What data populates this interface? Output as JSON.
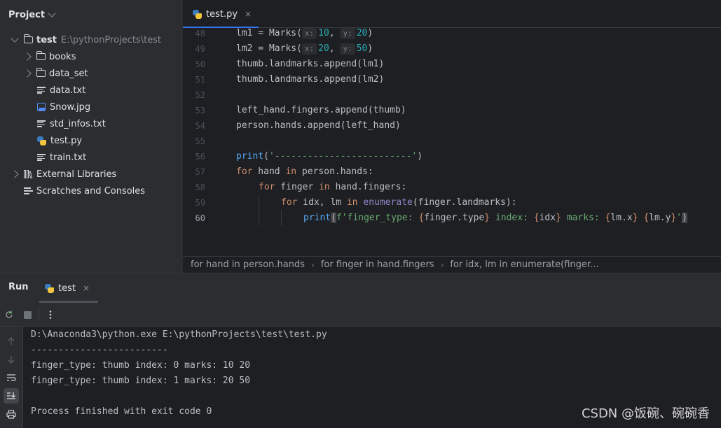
{
  "project_panel": {
    "title": "Project",
    "root": {
      "name": "test",
      "path": "E:\\pythonProjects\\test"
    },
    "items": [
      {
        "label": "books",
        "type": "folder"
      },
      {
        "label": "data_set",
        "type": "folder"
      },
      {
        "label": "data.txt",
        "type": "text-file"
      },
      {
        "label": "Snow.jpg",
        "type": "image-file"
      },
      {
        "label": "std_infos.txt",
        "type": "text-file"
      },
      {
        "label": "test.py",
        "type": "python-file"
      },
      {
        "label": "train.txt",
        "type": "text-file"
      }
    ],
    "external_libraries": "External Libraries",
    "scratches": "Scratches and Consoles"
  },
  "editor": {
    "tab_label": "test.py",
    "close_glyph": "×",
    "line_numbers": [
      "48",
      "49",
      "50",
      "51",
      "52",
      "53",
      "54",
      "55",
      "56",
      "57",
      "58",
      "59",
      "60"
    ],
    "lines": {
      "l48_a": "lm1 = Marks(",
      "l48_hint_x": "x:",
      "l48_x": "10",
      "l48_sep": ", ",
      "l48_hint_y": "y:",
      "l48_y": "20",
      "l48_end": ")",
      "l49_a": "lm2 = Marks(",
      "l49_hint_x": "x:",
      "l49_x": "20",
      "l49_sep": ", ",
      "l49_hint_y": "y:",
      "l49_y": "50",
      "l49_end": ")",
      "l50": "thumb.landmarks.append(lm1)",
      "l51": "thumb.landmarks.append(lm2)",
      "l53": "left_hand.fingers.append(thumb)",
      "l54": "person.hands.append(left_hand)",
      "l56_fn": "print",
      "l56_open": "(",
      "l56_str": "'-------------------------'",
      "l56_close": ")",
      "l57_for": "for",
      "l57_a": " hand ",
      "l57_in": "in",
      "l57_b": " person.hands:",
      "l58_for": "for",
      "l58_a": " finger ",
      "l58_in": "in",
      "l58_b": " hand.fingers:",
      "l59_for": "for",
      "l59_a": " idx, lm ",
      "l59_in": "in",
      "l59_fn": " enumerate",
      "l59_b": "(finger.landmarks):",
      "l60_fn": "print",
      "l60_open": "(",
      "l60_s1": "f'finger_type: ",
      "l60_b1": "{",
      "l60_v1": "finger.type",
      "l60_b2": "}",
      "l60_s2": " index: ",
      "l60_b3": "{",
      "l60_v2": "idx",
      "l60_b4": "}",
      "l60_s3": " marks: ",
      "l60_b5": "{",
      "l60_v3": "lm.x",
      "l60_b6": "}",
      "l60_s4": " ",
      "l60_b7": "{",
      "l60_v4": "lm.y",
      "l60_b8": "}",
      "l60_s5": "'",
      "l60_close": ")"
    }
  },
  "breadcrumb": {
    "items": [
      "for hand in person.hands",
      "for finger in hand.fingers",
      "for idx, lm in enumerate(finger..."
    ],
    "separator": "›"
  },
  "run_panel": {
    "title": "Run",
    "tab_label": "test",
    "close_glyph": "×",
    "output": [
      "D:\\Anaconda3\\python.exe E:\\pythonProjects\\test\\test.py",
      "-------------------------",
      "finger_type: thumb index: 0 marks: 10 20",
      "finger_type: thumb index: 1 marks: 20 50",
      "",
      "Process finished with exit code 0"
    ]
  },
  "watermark": "CSDN @饭碗、碗碗香",
  "colors": {
    "accent": "#3574f0",
    "keyword": "#cf8e6d",
    "number": "#2aacb8",
    "string": "#6aab73",
    "function": "#56a8f5"
  }
}
